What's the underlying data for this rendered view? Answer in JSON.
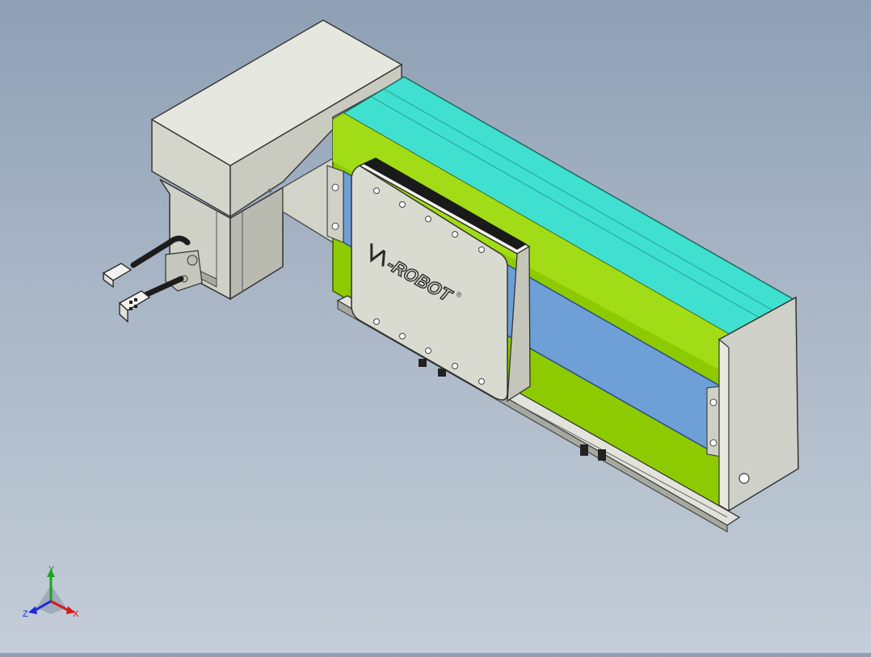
{
  "model": {
    "logo_text": "-ROBOT",
    "logo_registered": "®"
  },
  "triad": {
    "y_label": "Y",
    "x_label": "X",
    "z_label": "Z"
  },
  "colors": {
    "body_green": "#8ccc00",
    "body_green_light": "#a8e02a",
    "top_cyan": "#3fe0d0",
    "window_blue": "#6f9fd4",
    "housing_gray": "#e4e6dc",
    "slider_plate": "#d9dbd0"
  }
}
